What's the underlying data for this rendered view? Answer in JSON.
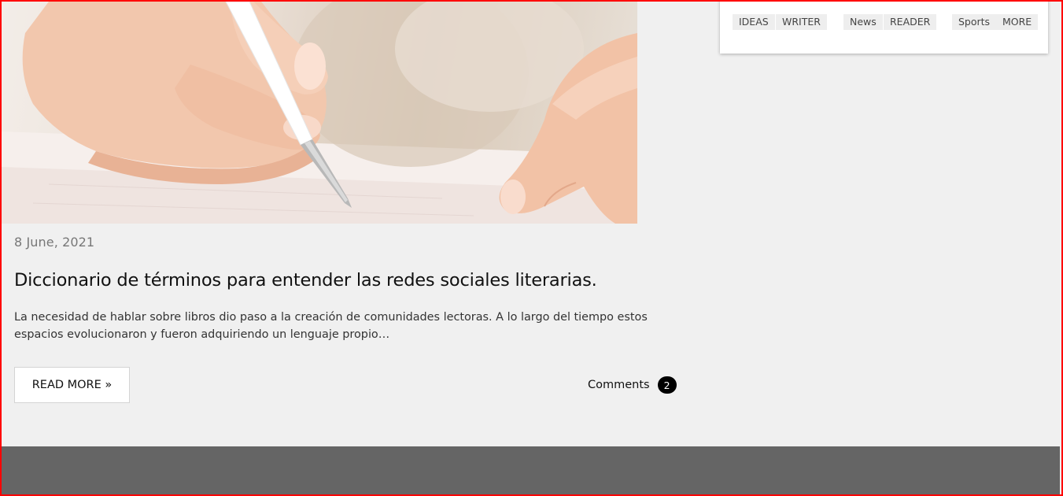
{
  "post": {
    "date": "8 June, 2021",
    "title": "Diccionario de términos para entender las redes sociales literarias.",
    "excerpt": "La necesidad de hablar sobre libros dio paso a la creación de comunidades lectoras. A lo largo del tiempo estos espacios evolucionaron y fueron adquiriendo un lenguaje propio…",
    "read_more_label": "READ MORE »",
    "comments_label": "Comments",
    "comments_count": "2"
  },
  "tags": [
    "IDEAS",
    "WRITER",
    "News",
    "READER",
    "Sports",
    "MORE"
  ],
  "colors": {
    "background": "#f0f0f0",
    "footer": "#656565",
    "frame_border": "#ff0000",
    "badge": "#000000"
  },
  "icons": {
    "hero_image": "hand-writing-with-pen-photo"
  }
}
